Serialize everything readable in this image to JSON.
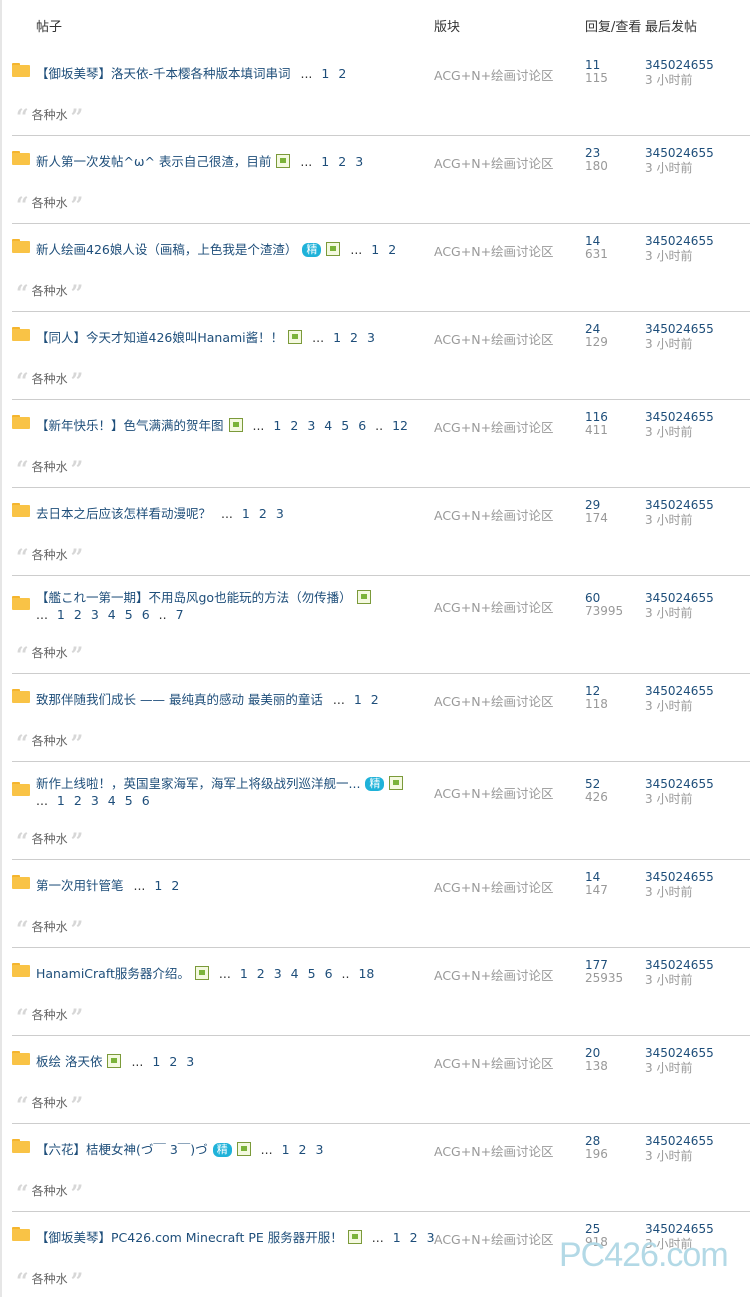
{
  "header": {
    "col_title": "帖子",
    "col_forum": "版块",
    "col_stats": "回复/查看",
    "col_last": "最后发帖"
  },
  "excerpt_text": "各种水",
  "threads": [
    {
      "title": "【御坂美琴】洛天依-千本樱各种版本填词串词",
      "forum": "ACG+N+绘画讨论区",
      "replies": "11",
      "views": "115",
      "last_user": "345024655",
      "last_time": "3 小时前",
      "pages": [
        "1",
        "2"
      ]
    },
    {
      "title": "新人第一次发帖^ω^ 表示自己很渣，目前",
      "forum": "ACG+N+绘画讨论区",
      "replies": "23",
      "views": "180",
      "last_user": "345024655",
      "last_time": "3 小时前",
      "pages": [
        "1",
        "2",
        "3"
      ]
    },
    {
      "title": "新人绘画426娘人设（画稿，上色我是个渣渣）",
      "forum": "ACG+N+绘画讨论区",
      "replies": "14",
      "views": "631",
      "last_user": "345024655",
      "last_time": "3 小时前",
      "pages": [
        "1",
        "2"
      ],
      "badge": "精"
    },
    {
      "title": "【同人】今天才知道426娘叫Hanami酱！！",
      "forum": "ACG+N+绘画讨论区",
      "replies": "24",
      "views": "129",
      "last_user": "345024655",
      "last_time": "3 小时前",
      "pages": [
        "1",
        "2",
        "3"
      ]
    },
    {
      "title": "【新年快乐！】色气满满的贺年图",
      "forum": "ACG+N+绘画讨论区",
      "replies": "116",
      "views": "411",
      "last_user": "345024655",
      "last_time": "3 小时前",
      "pages": [
        "1",
        "2",
        "3",
        "4",
        "5",
        "6",
        "..",
        "12"
      ]
    },
    {
      "title": "去日本之后应该怎样看动漫呢？",
      "forum": "ACG+N+绘画讨论区",
      "replies": "29",
      "views": "174",
      "last_user": "345024655",
      "last_time": "3 小时前",
      "pages": [
        "1",
        "2",
        "3"
      ]
    },
    {
      "title": "【艦これ一第一期】不用岛风go也能玩的方法（勿传播）",
      "forum": "ACG+N+绘画讨论区",
      "replies": "60",
      "views": "73995",
      "last_user": "345024655",
      "last_time": "3 小时前",
      "pages": [
        "1",
        "2",
        "3",
        "4",
        "5",
        "6",
        "..",
        "7"
      ]
    },
    {
      "title": "致那伴随我们成长 —— 最纯真的感动 最美丽的童话",
      "forum": "ACG+N+绘画讨论区",
      "replies": "12",
      "views": "118",
      "last_user": "345024655",
      "last_time": "3 小时前",
      "pages": [
        "1",
        "2"
      ]
    },
    {
      "title": "新作上线啦！，英国皇家海军，海军上将级战列巡洋舰一...",
      "forum": "ACG+N+绘画讨论区",
      "replies": "52",
      "views": "426",
      "last_user": "345024655",
      "last_time": "3 小时前",
      "pages": [
        "1",
        "2",
        "3",
        "4",
        "5",
        "6"
      ],
      "badge": "精"
    },
    {
      "title": "第一次用针管笔",
      "forum": "ACG+N+绘画讨论区",
      "replies": "14",
      "views": "147",
      "last_user": "345024655",
      "last_time": "3 小时前",
      "pages": [
        "1",
        "2"
      ]
    },
    {
      "title": "HanamiCraft服务器介绍。",
      "forum": "ACG+N+绘画讨论区",
      "replies": "177",
      "views": "25935",
      "last_user": "345024655",
      "last_time": "3 小时前",
      "pages": [
        "1",
        "2",
        "3",
        "4",
        "5",
        "6",
        "..",
        "18"
      ]
    },
    {
      "title": "板绘 洛天依",
      "forum": "ACG+N+绘画讨论区",
      "replies": "20",
      "views": "138",
      "last_user": "345024655",
      "last_time": "3 小时前",
      "pages": [
        "1",
        "2",
        "3"
      ]
    },
    {
      "title": "【六花】桔梗女神(づ￣ 3￣)づ",
      "forum": "ACG+N+绘画讨论区",
      "replies": "28",
      "views": "196",
      "last_user": "345024655",
      "last_time": "3 小时前",
      "pages": [
        "1",
        "2",
        "3"
      ],
      "badge": "精"
    },
    {
      "title": "【御坂美琴】PC426.com Minecraft PE 服务器开服！",
      "forum": "ACG+N+绘画讨论区",
      "replies": "25",
      "views": "918",
      "last_user": "345024655",
      "last_time": "3 小时前",
      "pages": [
        "1",
        "2",
        "3"
      ]
    }
  ],
  "watermark": "PC426.com"
}
